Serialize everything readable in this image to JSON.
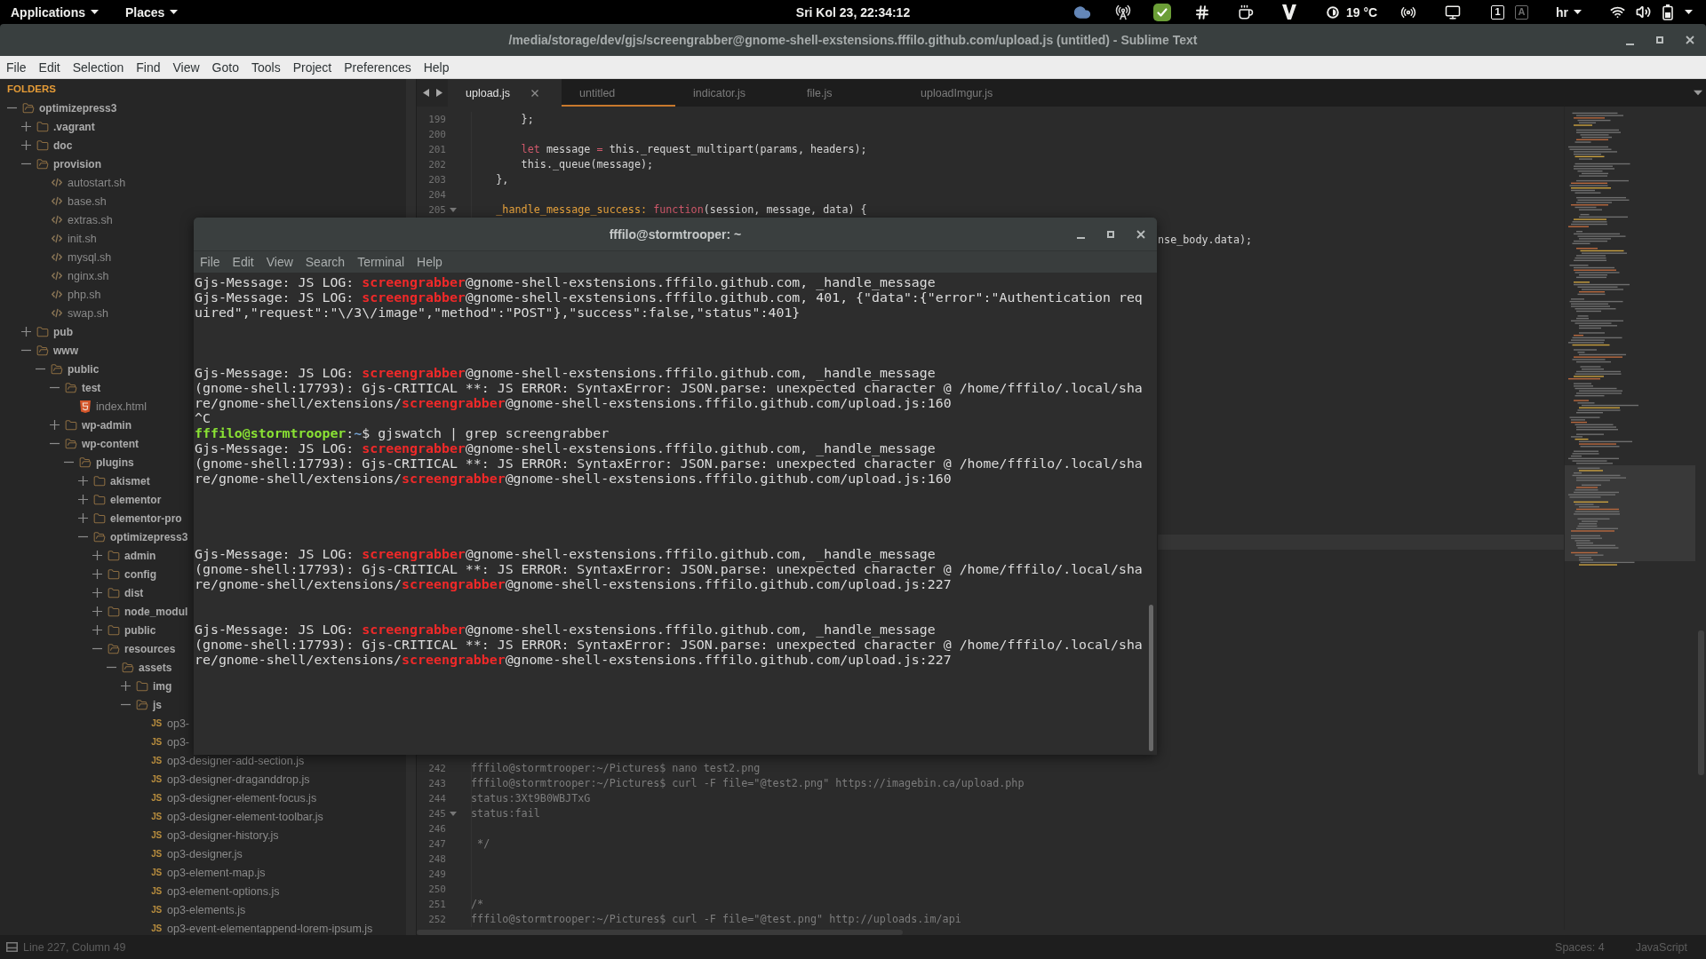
{
  "top_bar": {
    "menus": [
      "Applications",
      "Places"
    ],
    "clock": "Sri Kol 23, 22:34:12",
    "weather": "19 °C",
    "lock_indicators": [
      {
        "label": "1",
        "on": true
      },
      {
        "label": "A",
        "on": false
      }
    ],
    "keyboard_layout": "hr"
  },
  "window": {
    "title": "/media/storage/dev/gjs/screengrabber@gnome-shell-exstensions.fffilo.github.com/upload.js (untitled) - Sublime Text"
  },
  "menu": [
    "File",
    "Edit",
    "Selection",
    "Find",
    "View",
    "Goto",
    "Tools",
    "Project",
    "Preferences",
    "Help"
  ],
  "sidebar": {
    "heading": "FOLDERS",
    "tree": [
      {
        "name": "optimizepress3",
        "kind": "folder",
        "expanded": true,
        "children": [
          {
            "name": ".vagrant",
            "kind": "folder",
            "expanded": false
          },
          {
            "name": "doc",
            "kind": "folder",
            "expanded": false
          },
          {
            "name": "provision",
            "kind": "folder",
            "expanded": true,
            "children": [
              {
                "name": "autostart.sh",
                "kind": "shell"
              },
              {
                "name": "base.sh",
                "kind": "shell"
              },
              {
                "name": "extras.sh",
                "kind": "shell"
              },
              {
                "name": "init.sh",
                "kind": "shell"
              },
              {
                "name": "mysql.sh",
                "kind": "shell"
              },
              {
                "name": "nginx.sh",
                "kind": "shell"
              },
              {
                "name": "php.sh",
                "kind": "shell"
              },
              {
                "name": "swap.sh",
                "kind": "shell"
              }
            ]
          },
          {
            "name": "pub",
            "kind": "folder",
            "expanded": false
          },
          {
            "name": "www",
            "kind": "folder",
            "expanded": true,
            "children": [
              {
                "name": "public",
                "kind": "folder",
                "expanded": true,
                "children": [
                  {
                    "name": "test",
                    "kind": "folder",
                    "expanded": true,
                    "children": [
                      {
                        "name": "index.html",
                        "kind": "html"
                      }
                    ]
                  },
                  {
                    "name": "wp-admin",
                    "kind": "folder",
                    "expanded": false
                  },
                  {
                    "name": "wp-content",
                    "kind": "folder",
                    "expanded": true,
                    "children": [
                      {
                        "name": "plugins",
                        "kind": "folder",
                        "expanded": true,
                        "children": [
                          {
                            "name": "akismet",
                            "kind": "folder",
                            "expanded": false
                          },
                          {
                            "name": "elementor",
                            "kind": "folder",
                            "expanded": false
                          },
                          {
                            "name": "elementor-pro",
                            "kind": "folder",
                            "expanded": false
                          },
                          {
                            "name": "optimizepress3",
                            "kind": "folder",
                            "expanded": true,
                            "children": [
                              {
                                "name": "admin",
                                "kind": "folder",
                                "expanded": false
                              },
                              {
                                "name": "config",
                                "kind": "folder",
                                "expanded": false
                              },
                              {
                                "name": "dist",
                                "kind": "folder",
                                "expanded": false
                              },
                              {
                                "name": "node_modul",
                                "kind": "folder",
                                "expanded": false
                              },
                              {
                                "name": "public",
                                "kind": "folder",
                                "expanded": false
                              },
                              {
                                "name": "resources",
                                "kind": "folder",
                                "expanded": true,
                                "children": [
                                  {
                                    "name": "assets",
                                    "kind": "folder",
                                    "expanded": true,
                                    "children": [
                                      {
                                        "name": "img",
                                        "kind": "folder",
                                        "expanded": false
                                      },
                                      {
                                        "name": "js",
                                        "kind": "folder",
                                        "expanded": true,
                                        "children": [
                                          {
                                            "name": "op3-",
                                            "kind": "js",
                                            "badge": "JS"
                                          },
                                          {
                                            "name": "op3-",
                                            "kind": "js",
                                            "badge": "JS"
                                          },
                                          {
                                            "name": "op3-designer-add-section.js",
                                            "kind": "js",
                                            "badge": "JS"
                                          },
                                          {
                                            "name": "op3-designer-draganddrop.js",
                                            "kind": "js",
                                            "badge": "JS"
                                          },
                                          {
                                            "name": "op3-designer-element-focus.js",
                                            "kind": "js",
                                            "badge": "JS"
                                          },
                                          {
                                            "name": "op3-designer-element-toolbar.js",
                                            "kind": "js",
                                            "badge": "JS"
                                          },
                                          {
                                            "name": "op3-designer-history.js",
                                            "kind": "js",
                                            "badge": "JS"
                                          },
                                          {
                                            "name": "op3-designer.js",
                                            "kind": "js",
                                            "badge": "JS"
                                          },
                                          {
                                            "name": "op3-element-map.js",
                                            "kind": "js",
                                            "badge": "JS"
                                          },
                                          {
                                            "name": "op3-element-options.js",
                                            "kind": "js",
                                            "badge": "JS"
                                          },
                                          {
                                            "name": "op3-elements.js",
                                            "kind": "js",
                                            "badge": "JS"
                                          },
                                          {
                                            "name": "op3-event-elementappend-lorem-ipsum.js",
                                            "kind": "js",
                                            "badge": "JS"
                                          }
                                        ]
                                      }
                                    ]
                                  }
                                ]
                              }
                            ]
                          }
                        ]
                      }
                    ]
                  }
                ]
              }
            ]
          }
        ]
      }
    ]
  },
  "editor": {
    "tabs": [
      {
        "label": "upload.js",
        "selected": true,
        "underlined": false
      },
      {
        "label": "untitled",
        "selected": false,
        "underlined": true
      },
      {
        "label": "indicator.js",
        "selected": false,
        "underlined": false
      },
      {
        "label": "file.js",
        "selected": false,
        "underlined": false
      },
      {
        "label": "uploadImgur.js",
        "selected": false,
        "underlined": false
      }
    ],
    "rows": [
      {
        "kind": "code",
        "number": "199",
        "fold": false,
        "code": [
          {
            "kind": "plain",
            "text": "        };"
          }
        ]
      },
      {
        "kind": "code",
        "number": "200",
        "fold": false
      },
      {
        "kind": "code",
        "number": "201",
        "fold": false,
        "code": [
          {
            "kind": "keyword",
            "text": "        let"
          },
          {
            "kind": "plain",
            "text": " message "
          },
          {
            "kind": "keyword",
            "text": "="
          },
          {
            "kind": "plain",
            "text": " this._request_multipart(params, headers);"
          }
        ]
      },
      {
        "kind": "code",
        "number": "202",
        "fold": false,
        "code": [
          {
            "kind": "plain",
            "text": "        this._queue(message);"
          }
        ]
      },
      {
        "kind": "code",
        "number": "203",
        "fold": false,
        "code": [
          {
            "kind": "plain",
            "text": "    },"
          }
        ]
      },
      {
        "kind": "code",
        "number": "204",
        "fold": false
      },
      {
        "kind": "code",
        "number": "205",
        "fold": true,
        "code": [
          {
            "kind": "property",
            "text": "    _handle_message_success:"
          },
          {
            "kind": "keyword",
            "text": " function"
          },
          {
            "kind": "plain",
            "text": "(session, message, data) {"
          }
        ]
      },
      {
        "kind": "covered"
      },
      {
        "kind": "fragment",
        "code": [
          {
            "kind": "plain",
            "text": "nse_body.data);"
          }
        ]
      },
      {
        "kind": "covered"
      },
      {
        "kind": "covered"
      },
      {
        "kind": "covered"
      },
      {
        "kind": "covered"
      },
      {
        "kind": "covered"
      },
      {
        "kind": "covered"
      },
      {
        "kind": "covered"
      },
      {
        "kind": "covered"
      },
      {
        "kind": "covered"
      },
      {
        "kind": "covered"
      },
      {
        "kind": "covered"
      },
      {
        "kind": "covered"
      },
      {
        "kind": "covered"
      },
      {
        "kind": "covered"
      },
      {
        "kind": "covered"
      },
      {
        "kind": "covered"
      },
      {
        "kind": "covered"
      },
      {
        "kind": "covered"
      },
      {
        "kind": "covered"
      },
      {
        "kind": "current"
      },
      {
        "kind": "covered"
      },
      {
        "kind": "covered"
      },
      {
        "kind": "covered"
      },
      {
        "kind": "covered"
      },
      {
        "kind": "covered"
      },
      {
        "kind": "covered"
      },
      {
        "kind": "covered"
      },
      {
        "kind": "covered"
      },
      {
        "kind": "covered"
      },
      {
        "kind": "covered"
      },
      {
        "kind": "covered"
      },
      {
        "kind": "covered"
      },
      {
        "kind": "covered"
      },
      {
        "kind": "covered"
      },
      {
        "kind": "code",
        "number": "242",
        "fold": false,
        "code": [
          {
            "kind": "comment",
            "text": "fffilo@stormtrooper:~/Pictures$ nano test2.png"
          }
        ]
      },
      {
        "kind": "code",
        "number": "243",
        "fold": false,
        "code": [
          {
            "kind": "comment",
            "text": "fffilo@stormtrooper:~/Pictures$ curl -F file=\"@test2.png\" https://imagebin.ca/upload.php"
          }
        ]
      },
      {
        "kind": "code",
        "number": "244",
        "fold": false,
        "code": [
          {
            "kind": "comment",
            "text": "status:3Xt9B0WBJTxG"
          }
        ]
      },
      {
        "kind": "code",
        "number": "245",
        "fold": true,
        "code": [
          {
            "kind": "comment",
            "text": "status:fail"
          }
        ]
      },
      {
        "kind": "code",
        "number": "246",
        "fold": false
      },
      {
        "kind": "code",
        "number": "247",
        "fold": false,
        "code": [
          {
            "kind": "comment",
            "text": " */"
          }
        ]
      },
      {
        "kind": "code",
        "number": "248",
        "fold": false
      },
      {
        "kind": "code",
        "number": "249",
        "fold": false
      },
      {
        "kind": "code",
        "number": "250",
        "fold": false
      },
      {
        "kind": "code",
        "number": "251",
        "fold": false,
        "code": [
          {
            "kind": "comment",
            "text": "/*"
          }
        ]
      },
      {
        "kind": "code",
        "number": "252",
        "fold": false,
        "code": [
          {
            "kind": "comment",
            "text": "fffilo@stormtrooper:~/Pictures$ curl -F file=\"@test.png\" http://uploads.im/api"
          }
        ]
      }
    ]
  },
  "status_bar": {
    "position": "Line 227, Column 49",
    "indentation": "Spaces: 4",
    "syntax": "JavaScript"
  },
  "terminal": {
    "title": "fffilo@stormtrooper: ~",
    "menu": [
      "File",
      "Edit",
      "View",
      "Search",
      "Terminal",
      "Help"
    ],
    "lines": [
      {
        "kind": "text",
        "segments": [
          {
            "kind": "plain",
            "text": "Gjs-Message: JS LOG: "
          },
          {
            "kind": "match",
            "text": "screengrabber"
          },
          {
            "kind": "plain",
            "text": "@gnome-shell-exstensions.fffilo.github.com, _handle_message"
          }
        ]
      },
      {
        "kind": "text",
        "segments": [
          {
            "kind": "plain",
            "text": "Gjs-Message: JS LOG: "
          },
          {
            "kind": "match",
            "text": "screengrabber"
          },
          {
            "kind": "plain",
            "text": "@gnome-shell-exstensions.fffilo.github.com, 401, {\"data\":{\"error\":\"Authentication req"
          }
        ]
      },
      {
        "kind": "text",
        "segments": [
          {
            "kind": "plain",
            "text": "uired\",\"request\":\"\\/3\\/image\",\"method\":\"POST\"},\"success\":false,\"status\":401}"
          }
        ]
      },
      {
        "kind": "blank"
      },
      {
        "kind": "blank"
      },
      {
        "kind": "blank"
      },
      {
        "kind": "text",
        "segments": [
          {
            "kind": "plain",
            "text": "Gjs-Message: JS LOG: "
          },
          {
            "kind": "match",
            "text": "screengrabber"
          },
          {
            "kind": "plain",
            "text": "@gnome-shell-exstensions.fffilo.github.com, _handle_message"
          }
        ]
      },
      {
        "kind": "text",
        "segments": [
          {
            "kind": "plain",
            "text": "(gnome-shell:17793): Gjs-CRITICAL **: JS ERROR: SyntaxError: JSON.parse: unexpected character @ /home/fffilo/.local/sha"
          }
        ]
      },
      {
        "kind": "text",
        "segments": [
          {
            "kind": "plain",
            "text": "re/gnome-shell/extensions/"
          },
          {
            "kind": "match",
            "text": "screengrabber"
          },
          {
            "kind": "plain",
            "text": "@gnome-shell-exstensions.fffilo.github.com/upload.js:160"
          }
        ]
      },
      {
        "kind": "text",
        "segments": [
          {
            "kind": "plain",
            "text": "^C"
          }
        ]
      },
      {
        "kind": "text",
        "segments": [
          {
            "kind": "user",
            "text": "fffilo@stormtrooper"
          },
          {
            "kind": "plain",
            "text": ":"
          },
          {
            "kind": "path",
            "text": "~"
          },
          {
            "kind": "plain",
            "text": "$ gjswatch | grep screengrabber"
          }
        ]
      },
      {
        "kind": "text",
        "segments": [
          {
            "kind": "plain",
            "text": "Gjs-Message: JS LOG: "
          },
          {
            "kind": "match",
            "text": "screengrabber"
          },
          {
            "kind": "plain",
            "text": "@gnome-shell-exstensions.fffilo.github.com, _handle_message"
          }
        ]
      },
      {
        "kind": "text",
        "segments": [
          {
            "kind": "plain",
            "text": "(gnome-shell:17793): Gjs-CRITICAL **: JS ERROR: SyntaxError: JSON.parse: unexpected character @ /home/fffilo/.local/sha"
          }
        ]
      },
      {
        "kind": "text",
        "segments": [
          {
            "kind": "plain",
            "text": "re/gnome-shell/extensions/"
          },
          {
            "kind": "match",
            "text": "screengrabber"
          },
          {
            "kind": "plain",
            "text": "@gnome-shell-exstensions.fffilo.github.com/upload.js:160"
          }
        ]
      },
      {
        "kind": "blank"
      },
      {
        "kind": "blank"
      },
      {
        "kind": "blank"
      },
      {
        "kind": "blank"
      },
      {
        "kind": "text",
        "segments": [
          {
            "kind": "plain",
            "text": "Gjs-Message: JS LOG: "
          },
          {
            "kind": "match",
            "text": "screengrabber"
          },
          {
            "kind": "plain",
            "text": "@gnome-shell-exstensions.fffilo.github.com, _handle_message"
          }
        ]
      },
      {
        "kind": "text",
        "segments": [
          {
            "kind": "plain",
            "text": "(gnome-shell:17793): Gjs-CRITICAL **: JS ERROR: SyntaxError: JSON.parse: unexpected character @ /home/fffilo/.local/sha"
          }
        ]
      },
      {
        "kind": "text",
        "segments": [
          {
            "kind": "plain",
            "text": "re/gnome-shell/extensions/"
          },
          {
            "kind": "match",
            "text": "screengrabber"
          },
          {
            "kind": "plain",
            "text": "@gnome-shell-exstensions.fffilo.github.com/upload.js:227"
          }
        ]
      },
      {
        "kind": "blank"
      },
      {
        "kind": "blank"
      },
      {
        "kind": "text",
        "segments": [
          {
            "kind": "plain",
            "text": "Gjs-Message: JS LOG: "
          },
          {
            "kind": "match",
            "text": "screengrabber"
          },
          {
            "kind": "plain",
            "text": "@gnome-shell-exstensions.fffilo.github.com, _handle_message"
          }
        ]
      },
      {
        "kind": "text",
        "segments": [
          {
            "kind": "plain",
            "text": "(gnome-shell:17793): Gjs-CRITICAL **: JS ERROR: SyntaxError: JSON.parse: unexpected character @ /home/fffilo/.local/sha"
          }
        ]
      },
      {
        "kind": "text",
        "segments": [
          {
            "kind": "plain",
            "text": "re/gnome-shell/extensions/"
          },
          {
            "kind": "match",
            "text": "screengrabber"
          },
          {
            "kind": "plain",
            "text": "@gnome-shell-exstensions.fffilo.github.com/upload.js:227"
          }
        ]
      }
    ]
  }
}
